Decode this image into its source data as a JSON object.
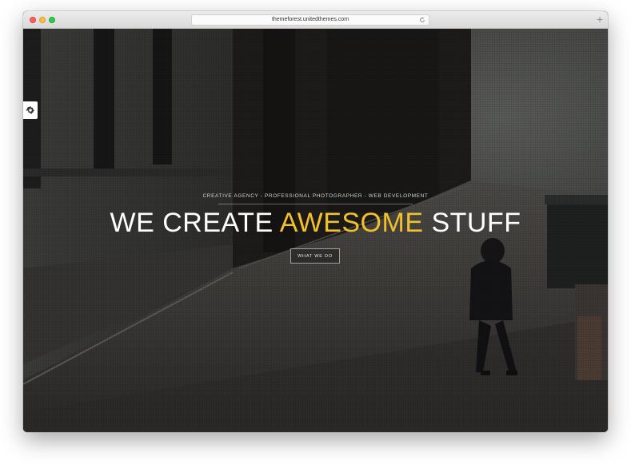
{
  "browser": {
    "url": "themeforest.unitedthemes.com",
    "reload_icon": "reload-icon",
    "new_tab_symbol": "+"
  },
  "hero": {
    "tagline": "CREATIVE AGENCY - PROFESSIONAL PHOTOGRAPHER - WEB DEVELOPMENT",
    "headline_part1": "WE CREATE ",
    "headline_accent": "AWESOME",
    "headline_part2": " STUFF",
    "cta_label": "WHAT WE DO",
    "accent_color": "#f2c02a",
    "settings_icon": "gear-icon"
  }
}
